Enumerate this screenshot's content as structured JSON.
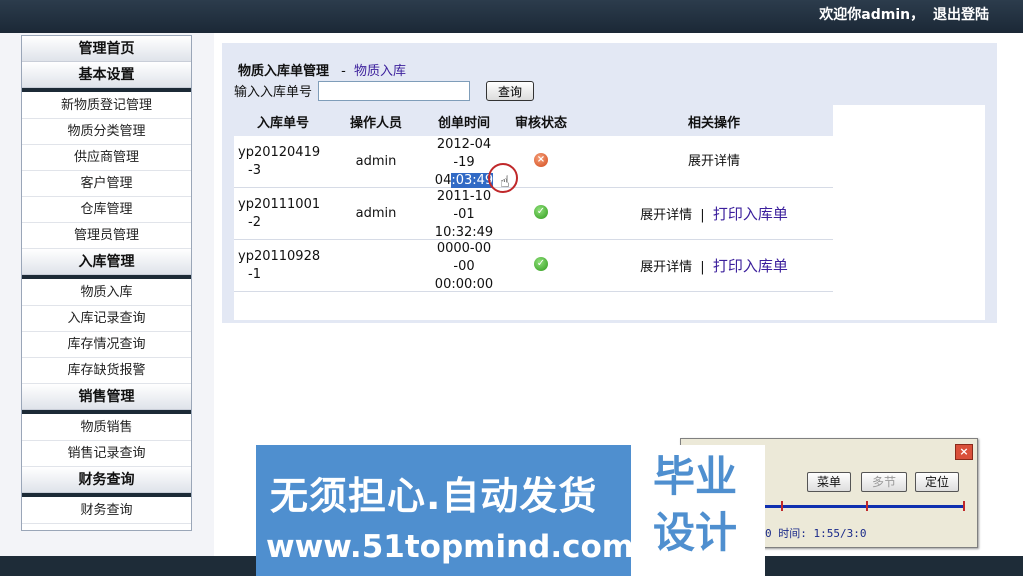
{
  "topbar": {
    "welcome": "欢迎你admin，",
    "logout": "退出登陆"
  },
  "sidebar": {
    "items": [
      {
        "type": "head",
        "label": "管理首页"
      },
      {
        "type": "group",
        "label": "基本设置"
      },
      {
        "type": "item",
        "label": "新物质登记管理"
      },
      {
        "type": "item",
        "label": "物质分类管理"
      },
      {
        "type": "item",
        "label": "供应商管理"
      },
      {
        "type": "item",
        "label": "客户管理"
      },
      {
        "type": "item",
        "label": "仓库管理"
      },
      {
        "type": "item",
        "label": "管理员管理"
      },
      {
        "type": "group",
        "label": "入库管理"
      },
      {
        "type": "item",
        "label": "物质入库"
      },
      {
        "type": "item",
        "label": "入库记录查询"
      },
      {
        "type": "item",
        "label": "库存情况查询"
      },
      {
        "type": "item",
        "label": "库存缺货报警"
      },
      {
        "type": "group",
        "label": "销售管理"
      },
      {
        "type": "item",
        "label": "物质销售"
      },
      {
        "type": "item",
        "label": "销售记录查询"
      },
      {
        "type": "group",
        "label": "财务查询"
      },
      {
        "type": "item",
        "label": "财务查询"
      }
    ]
  },
  "main": {
    "title": "物质入库单管理",
    "separator": "-",
    "subtitle": "物质入库",
    "search_label": "输入入库单号",
    "search_value": "",
    "search_button": "查询",
    "columns": [
      "入库单号",
      "操作人员",
      "创单时间",
      "审核状态",
      "相关操作"
    ],
    "rows": [
      {
        "id_l1": "yp20120419",
        "id_l2": "-3",
        "operator": "admin",
        "t1": "2012-04",
        "t2": "-19",
        "t3a": "04",
        "t3b": ":03:49",
        "status": "rejected",
        "detail": "展开详情",
        "divider": "",
        "print": ""
      },
      {
        "id_l1": "yp20111001",
        "id_l2": "-2",
        "operator": "admin",
        "t1": "2011-10",
        "t2": "-01",
        "t3a": "10:32:49",
        "t3b": "",
        "status": "approved",
        "detail": "展开详情",
        "divider": "|",
        "print": "打印入库单"
      },
      {
        "id_l1": "yp20110928",
        "id_l2": "-1",
        "operator": "",
        "t1": "0000-00",
        "t2": "-00",
        "t3a": "00:00:00",
        "t3b": "",
        "status": "approved",
        "detail": "展开详情",
        "divider": "|",
        "print": "打印入库单"
      }
    ]
  },
  "player": {
    "buttons": [
      "菜单",
      "多节",
      "定位"
    ],
    "time_text": "0 时间: 1:55/3:0",
    "progress": 0.66
  },
  "banner": {
    "line1": "无须担心.自动发货",
    "line2": "www.51topmind.com",
    "logo_l1": "毕业",
    "logo_l2": "设计"
  },
  "colors": {
    "topbar": "#1b2836",
    "link": "#3b1f9c",
    "panel": "#e3e8f4",
    "banner": "#4f8fcf"
  }
}
